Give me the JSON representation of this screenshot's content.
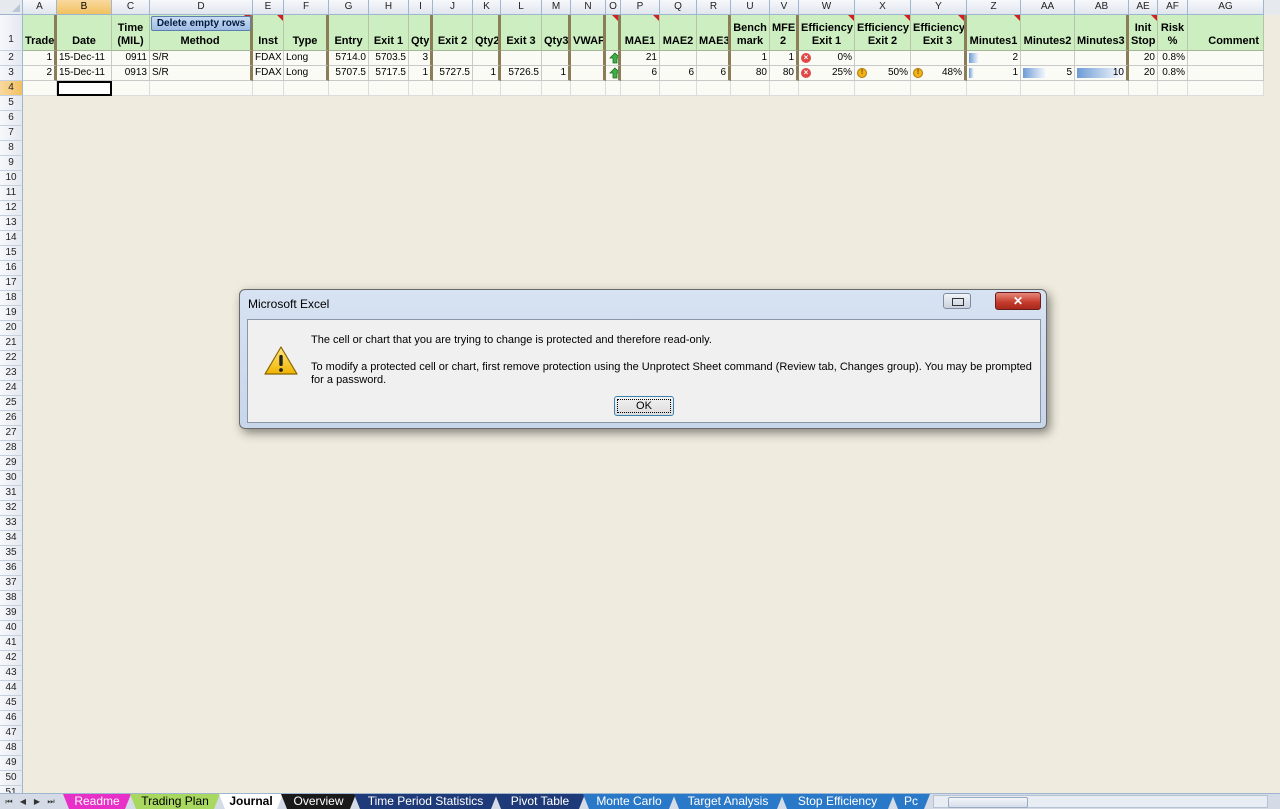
{
  "sheet": {
    "columns": [
      "A",
      "B",
      "C",
      "D",
      "E",
      "F",
      "G",
      "H",
      "I",
      "J",
      "K",
      "L",
      "M",
      "N",
      "O",
      "P",
      "Q",
      "R",
      "U",
      "V",
      "W",
      "X",
      "Y",
      "Z",
      "AA",
      "AB",
      "AE",
      "AF",
      "AG"
    ],
    "selected_column": "B",
    "rows": [
      "1",
      "2",
      "3",
      "4",
      "5",
      "6",
      "7",
      "8",
      "9",
      "10",
      "11",
      "12",
      "13",
      "14",
      "15",
      "16",
      "17",
      "18",
      "19",
      "20",
      "21",
      "22",
      "23",
      "24",
      "25",
      "26",
      "27",
      "28",
      "29",
      "30",
      "31",
      "32",
      "33",
      "34",
      "35",
      "36",
      "37",
      "38",
      "39",
      "40",
      "41",
      "42",
      "43",
      "44",
      "45",
      "46",
      "47",
      "48",
      "49",
      "50",
      "51"
    ],
    "selected_row": "4",
    "delete_button_label": "Delete empty rows",
    "headers": {
      "A": "Trade",
      "B": "Date",
      "C": "Time (MIL)",
      "D": "Method",
      "E": "Inst",
      "F": "Type",
      "G": "Entry",
      "H": "Exit 1",
      "I": "Qty",
      "J": "Exit 2",
      "K": "Qty2",
      "L": "Exit 3",
      "M": "Qty3",
      "N": "VWAP",
      "O": "",
      "P": "MAE1",
      "Q": "MAE2",
      "R": "MAE3",
      "U": "Bench mark",
      "V": "MFE 2",
      "W": "Efficiency Exit 1",
      "X": "Efficiency Exit 2",
      "Y": "Efficiency Exit 3",
      "Z": "Minutes1",
      "AA": "Minutes2",
      "AB": "Minutes3",
      "AE": "Init Stop",
      "AF": "Risk %",
      "AG": "Comment"
    },
    "data": [
      {
        "A": "1",
        "B": "15-Dec-11",
        "C": "0911",
        "D": "S/R",
        "E": "FDAX",
        "F": "Long",
        "G": "5714.0",
        "H": "5703.5",
        "I": "3",
        "J": "",
        "K": "",
        "L": "",
        "M": "",
        "N": "",
        "P": "21",
        "Q": "",
        "R": "",
        "U": "1",
        "V": "1",
        "W": "0%",
        "X": "",
        "Y": "",
        "Z": "2",
        "AA": "",
        "AB": "",
        "AE": "20",
        "AF": "0.8%",
        "AG": ""
      },
      {
        "A": "2",
        "B": "15-Dec-11",
        "C": "0913",
        "D": "S/R",
        "E": "FDAX",
        "F": "Long",
        "G": "5707.5",
        "H": "5717.5",
        "I": "1",
        "J": "5727.5",
        "K": "1",
        "L": "5726.5",
        "M": "1",
        "N": "",
        "P": "6",
        "Q": "6",
        "R": "6",
        "U": "80",
        "V": "80",
        "W": "25%",
        "X": "50%",
        "Y": "48%",
        "Z": "1",
        "AA": "5",
        "AB": "10",
        "AE": "20",
        "AF": "0.8%",
        "AG": ""
      }
    ],
    "minutes_fill": {
      "row1": {
        "Z": 0.2
      },
      "row2": {
        "Z": 0.1,
        "AA": 0.5,
        "AB": 1.0
      }
    }
  },
  "dialog": {
    "title": "Microsoft Excel",
    "close_glyph": "✕",
    "message_1": "The cell or chart that you are trying to change is protected and therefore read-only.",
    "message_2": "To modify a protected cell or chart, first remove protection using the Unprotect Sheet command (Review tab, Changes group). You may be prompted for a password.",
    "ok_label": "OK",
    "icon": "warning-icon"
  },
  "tabs": [
    {
      "label": "Readme",
      "color": "#e830c8"
    },
    {
      "label": "Trading Plan",
      "color": "#a8d860",
      "text": "#000"
    },
    {
      "label": "Journal",
      "active": true
    },
    {
      "label": "Overview",
      "color": "#1a1a1a"
    },
    {
      "label": "Time Period Statistics",
      "color": "#1e3a78"
    },
    {
      "label": "Pivot Table",
      "color": "#1e3a78"
    },
    {
      "label": "Monte Carlo",
      "color": "#2a78c8"
    },
    {
      "label": "Target Analysis",
      "color": "#2a78c8"
    },
    {
      "label": "Stop Efficiency",
      "color": "#2a78c8"
    },
    {
      "label": "Pc",
      "color": "#2a78c8"
    }
  ],
  "colors": {
    "header_green": "#cdeec0",
    "selection": "#f1c15f",
    "bar_blue": "#6e9bd6"
  }
}
